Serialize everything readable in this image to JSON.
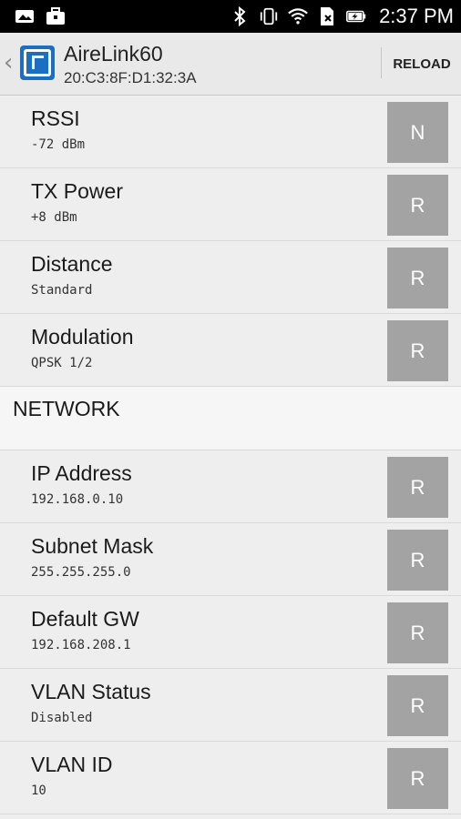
{
  "status_bar": {
    "time": "2:37 PM",
    "left_icons": [
      "gallery-icon",
      "briefcase-icon"
    ],
    "right_icons": [
      "bluetooth-icon",
      "vibrate-icon",
      "wifi-icon",
      "sim-icon",
      "battery-charging-icon"
    ]
  },
  "app_bar": {
    "title": "AireLink60",
    "subtitle": "20:C3:8F:D1:32:3A",
    "reload_label": "RELOAD"
  },
  "rows_top": [
    {
      "label": "RSSI",
      "value": "-72 dBm",
      "button": "N"
    },
    {
      "label": "TX Power",
      "value": "+8 dBm",
      "button": "R"
    },
    {
      "label": "Distance",
      "value": "Standard",
      "button": "R"
    },
    {
      "label": "Modulation",
      "value": "QPSK 1/2",
      "button": "R"
    }
  ],
  "section": {
    "label": "NETWORK"
  },
  "rows_network": [
    {
      "label": "IP Address",
      "value": "192.168.0.10",
      "button": "R"
    },
    {
      "label": "Subnet Mask",
      "value": "255.255.255.0",
      "button": "R"
    },
    {
      "label": "Default GW",
      "value": "192.168.208.1",
      "button": "R"
    },
    {
      "label": "VLAN Status",
      "value": "Disabled",
      "button": "R"
    },
    {
      "label": "VLAN ID",
      "value": "10",
      "button": "R"
    }
  ],
  "colors": {
    "status_bar": "#000000",
    "app_bar": "#e9e9e9",
    "button": "#a3a3a3",
    "logo": "#1a6fc0"
  }
}
